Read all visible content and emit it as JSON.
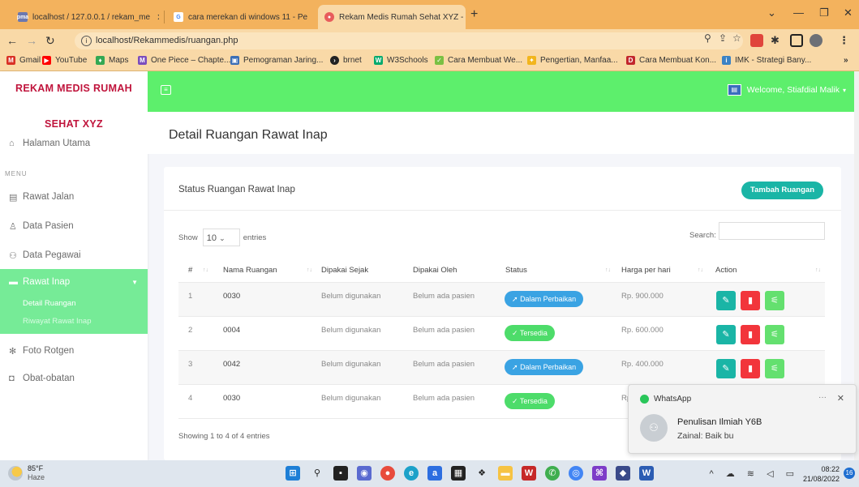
{
  "browser": {
    "tabs": [
      {
        "title": "localhost / 127.0.0.1 / rekam_me",
        "icon": "phpmyadmin-icon"
      },
      {
        "title": "cara merekan di windows 11 - Pe",
        "icon": "google-icon"
      },
      {
        "title": "Rekam Medis Rumah Sehat XYZ -",
        "icon": "page-icon"
      }
    ],
    "url": "localhost/Rekammedis/ruangan.php",
    "bookmarks": [
      "Gmail",
      "YouTube",
      "Maps",
      "One Piece – Chapte...",
      "Pemograman Jaring...",
      "brnet",
      "W3Schools",
      "Cara Membuat We...",
      "Pengertian, Manfaa...",
      "Cara Membuat Kon...",
      "IMK - Strategi Bany..."
    ]
  },
  "brand": {
    "line1": "REKAM MEDIS RUMAH",
    "line2": "SEHAT XYZ"
  },
  "sidebar": {
    "home": "Halaman Utama",
    "menu_label": "MENU",
    "items": [
      "Rawat Jalan",
      "Data Pasien",
      "Data Pegawai",
      "Rawat Inap",
      "Foto Rotgen",
      "Obat-obatan"
    ],
    "sub": [
      "Detail Ruangan",
      "Riwayat Rawat Inap"
    ]
  },
  "topbar": {
    "welcome": "Welcome, Stiafdial Malik"
  },
  "page": {
    "title": "Detail Ruangan Rawat Inap"
  },
  "card": {
    "title": "Status Ruangan Rawat Inap",
    "add_label": "Tambah Ruangan",
    "show_label": "Show",
    "entries_value": "10",
    "entries_label": "entries",
    "search_label": "Search:",
    "footer": "Showing 1 to 4 of 4 entries"
  },
  "table": {
    "headers": [
      "#",
      "Nama Ruangan",
      "Dipakai Sejak",
      "Dipakai Oleh",
      "Status",
      "Harga per hari",
      "Action"
    ],
    "rows": [
      {
        "no": "1",
        "nama": "0030",
        "sejak": "Belum digunakan",
        "oleh": "Belum ada pasien",
        "status": "Dalam Perbaikan",
        "harga": "Rp. 900.000"
      },
      {
        "no": "2",
        "nama": "0004",
        "sejak": "Belum digunakan",
        "oleh": "Belum ada pasien",
        "status": "Tersedia",
        "harga": "Rp. 600.000"
      },
      {
        "no": "3",
        "nama": "0042",
        "sejak": "Belum digunakan",
        "oleh": "Belum ada pasien",
        "status": "Dalam Perbaikan",
        "harga": "Rp. 400.000"
      },
      {
        "no": "4",
        "nama": "0030",
        "sejak": "Belum digunakan",
        "oleh": "Belum ada pasien",
        "status": "Tersedia",
        "harga": "Rp"
      }
    ]
  },
  "toast": {
    "app": "WhatsApp",
    "title": "Penulisan Ilmiah Y6B",
    "message": "Zainal: Baik bu",
    "more": "···"
  },
  "taskbar": {
    "temp": "85°F",
    "weather": "Haze",
    "time": "08:22",
    "date": "21/08/2022",
    "notifications": "16"
  },
  "colors": {
    "accent_green": "#5def6c",
    "sidebar_active": "#76eb97",
    "brand_red": "#c0143c",
    "teal": "#1ab5a6",
    "danger": "#f2353b",
    "info": "#3aa3e3"
  }
}
